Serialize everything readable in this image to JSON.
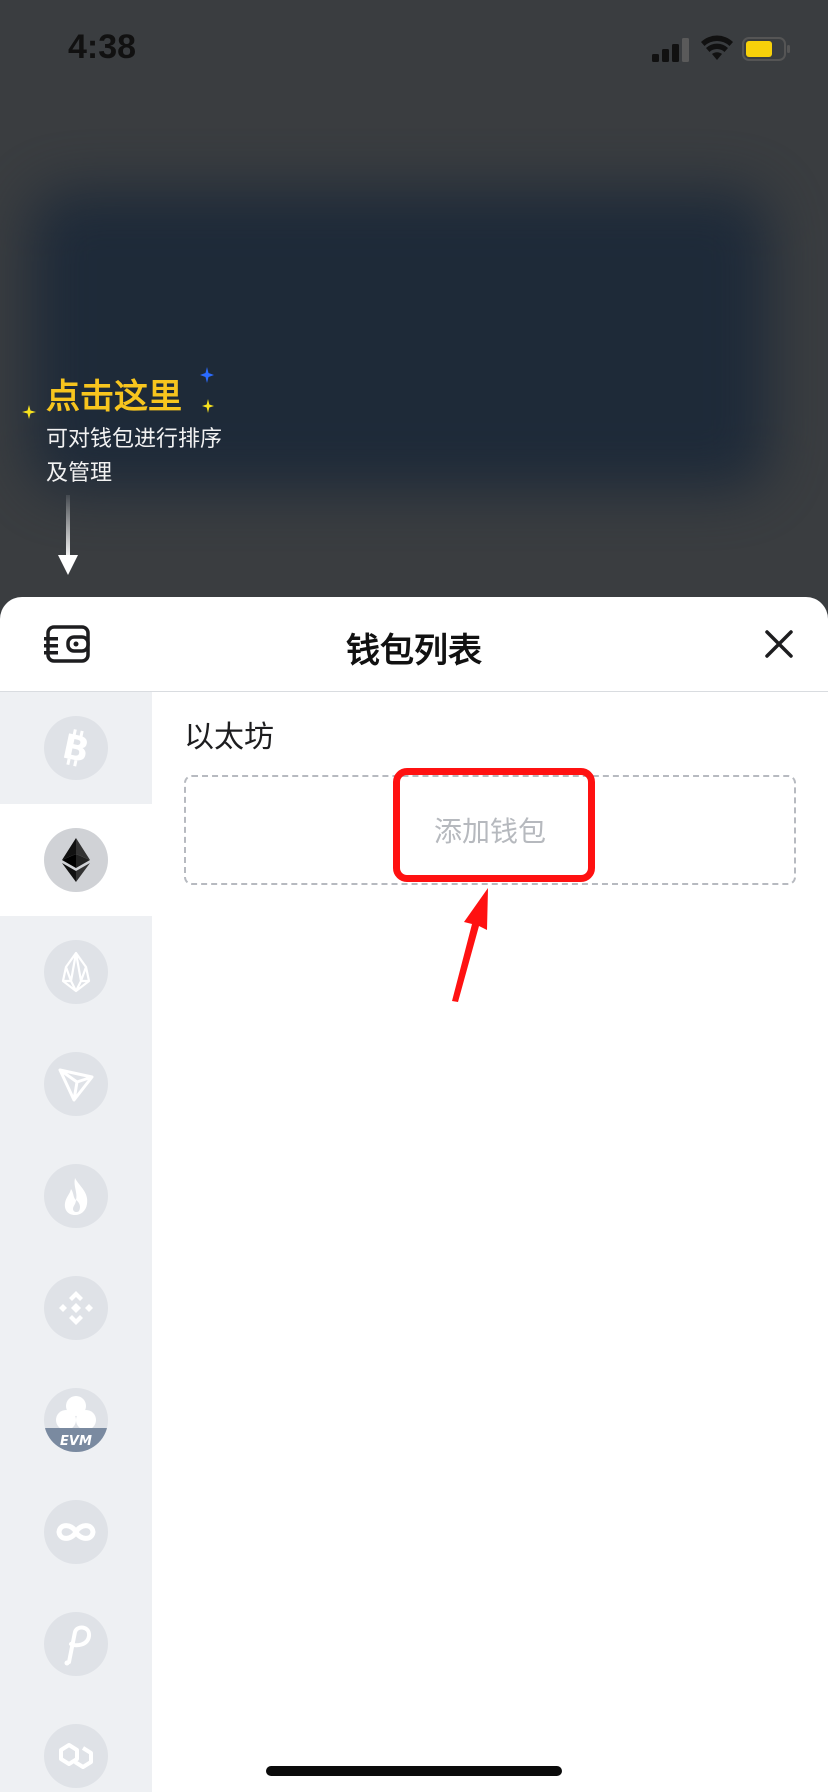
{
  "status_bar": {
    "time": "4:38",
    "icons": [
      "signal-icon",
      "wifi-icon",
      "battery-icon"
    ]
  },
  "hint": {
    "title": "点击这里",
    "description": "可对钱包进行排序及管理",
    "accent_color": "#f7c51e"
  },
  "sheet": {
    "title": "钱包列表",
    "manage_icon": "wallet-manage-icon",
    "close_icon": "close-icon"
  },
  "sidebar": {
    "items": [
      {
        "icon": "bitcoin-icon",
        "active": false
      },
      {
        "icon": "ethereum-icon",
        "active": true
      },
      {
        "icon": "eos-icon",
        "active": false
      },
      {
        "icon": "tron-icon",
        "active": false
      },
      {
        "icon": "heco-flame-icon",
        "active": false
      },
      {
        "icon": "bnb-icon",
        "active": false
      },
      {
        "icon": "evm-icon",
        "active": false,
        "label": "EVM"
      },
      {
        "icon": "infinity-icon",
        "active": false
      },
      {
        "icon": "polkadot-icon",
        "active": false
      },
      {
        "icon": "polygon-icon",
        "active": false
      }
    ]
  },
  "main": {
    "chain_name": "以太坊",
    "add_wallet_label": "添加钱包",
    "highlight_color": "#ff1111"
  }
}
